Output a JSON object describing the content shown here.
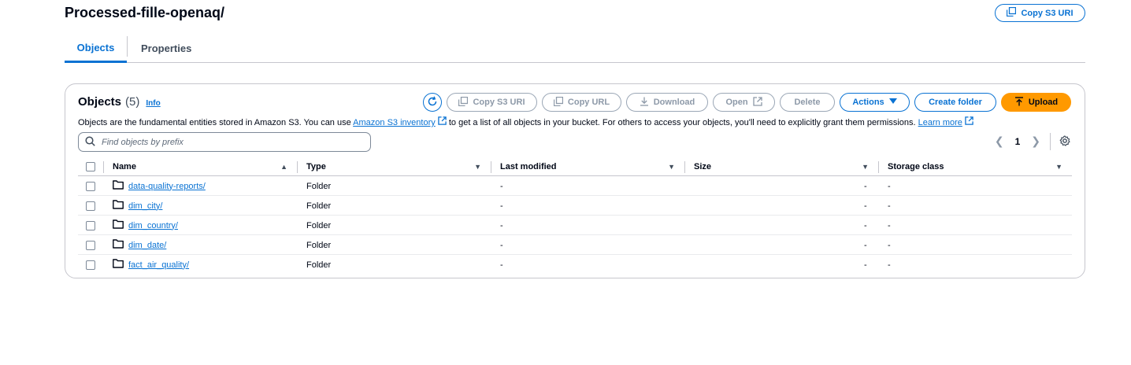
{
  "header": {
    "title": "Processed-fille-openaq/",
    "copy_uri_label": "Copy S3 URI"
  },
  "tabs": [
    {
      "label": "Objects",
      "active": true
    },
    {
      "label": "Properties",
      "active": false
    }
  ],
  "panel": {
    "title": "Objects",
    "count": "(5)",
    "info_label": "Info",
    "toolbar": {
      "copy_s3_uri": "Copy S3 URI",
      "copy_url": "Copy URL",
      "download": "Download",
      "open": "Open",
      "delete": "Delete",
      "actions": "Actions",
      "create_folder": "Create folder",
      "upload": "Upload"
    },
    "description": {
      "part1": "Objects are the fundamental entities stored in Amazon S3. You can use ",
      "link1": "Amazon S3 inventory",
      "part2": " to get a list of all objects in your bucket. For others to access your objects, you'll need to explicitly grant them permissions. ",
      "link2": "Learn more"
    },
    "search_placeholder": "Find objects by prefix",
    "pagination": {
      "current_page": "1"
    }
  },
  "table": {
    "columns": [
      "Name",
      "Type",
      "Last modified",
      "Size",
      "Storage class"
    ],
    "rows": [
      {
        "name": "data-quality-reports/",
        "type": "Folder",
        "last_modified": "-",
        "size": "-",
        "storage_class": "-"
      },
      {
        "name": "dim_city/",
        "type": "Folder",
        "last_modified": "-",
        "size": "-",
        "storage_class": "-"
      },
      {
        "name": "dim_country/",
        "type": "Folder",
        "last_modified": "-",
        "size": "-",
        "storage_class": "-"
      },
      {
        "name": "dim_date/",
        "type": "Folder",
        "last_modified": "-",
        "size": "-",
        "storage_class": "-"
      },
      {
        "name": "fact_air_quality/",
        "type": "Folder",
        "last_modified": "-",
        "size": "-",
        "storage_class": "-"
      }
    ]
  },
  "icons": {
    "copy": "copy-icon",
    "refresh": "refresh-icon",
    "download": "download-icon",
    "external": "external-link-icon",
    "caret_down": "caret-down-icon",
    "upload": "upload-icon",
    "search": "search-icon",
    "folder": "folder-icon",
    "settings": "gear-icon"
  },
  "colors": {
    "accent": "#0972d3",
    "upload": "#ff9900",
    "border": "#c6c6cd"
  }
}
